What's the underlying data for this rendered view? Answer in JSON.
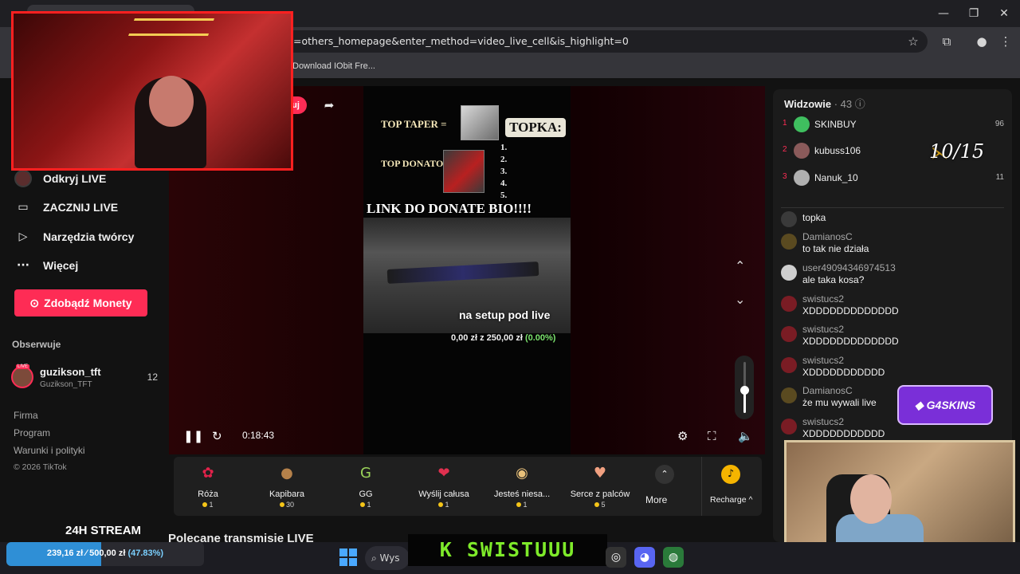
{
  "browser": {
    "url": "=others_homepage&enter_method=video_live_cell&is_highlight=0",
    "bookmark": "Download IObit Fre...",
    "window_controls": [
      "minimize-icon",
      "restore-icon",
      "close-icon"
    ]
  },
  "sidebar": {
    "nav": [
      {
        "label": "Odkryj LIVE",
        "icon": "avatar-icon"
      },
      {
        "label": "ZACZNIJ LIVE",
        "icon": "camera-icon"
      },
      {
        "label": "Narzędzia twórcy",
        "icon": "play-icon"
      },
      {
        "label": "Więcej",
        "icon": "more-dots-icon"
      }
    ],
    "coins_button": "Zdobądź Monety",
    "following_title": "Obserwuje",
    "following": {
      "name": "guzikson_tft",
      "handle": "Guzikson_TFT",
      "count": "12",
      "badge": "LIVE"
    },
    "footer": [
      "Firma",
      "Program",
      "Warunki i polityki"
    ],
    "copyright": "© 2026 TikTok",
    "stream_label": "24H STREAM"
  },
  "player": {
    "follow_short": "uj",
    "overlay": {
      "top_taper": "TOP TAPER =",
      "topka": "TOPKA:",
      "top_donator": "TOP DONATOR:",
      "numbers": [
        "1.",
        "2.",
        "3.",
        "4.",
        "5."
      ],
      "link": "LINK DO DONATE BIO!!!!",
      "caption": "na setup pod live",
      "goal_amount": "0,00 zł z 250,00 zł",
      "goal_percent": "(0.00%)"
    },
    "time": "0:18:43",
    "volume_level": 0.45
  },
  "gifts": {
    "items": [
      {
        "name": "Róża",
        "price": "1",
        "icon": "rose-icon",
        "color": "#e0224a"
      },
      {
        "name": "Kapibara",
        "price": "30",
        "icon": "capybara-icon",
        "color": "#b5814a"
      },
      {
        "name": "GG",
        "price": "1",
        "icon": "gg-icon",
        "color": "#9bd45a"
      },
      {
        "name": "Wyślij całusa",
        "price": "1",
        "icon": "lips-icon",
        "color": "#e0304f"
      },
      {
        "name": "Jesteś niesa...",
        "price": "1",
        "icon": "cat-icon",
        "color": "#e8c07a"
      },
      {
        "name": "Serce z palców",
        "price": "5",
        "icon": "finger-heart-icon",
        "color": "#f0a080"
      }
    ],
    "more": "More",
    "recharge": "Recharge ^"
  },
  "recommended_title": "Polecane transmisje LIVE",
  "chat": {
    "header": "Widzowie",
    "viewer_count": "· 43",
    "ranking": [
      {
        "rank": "1",
        "name": "SKINBUY",
        "score": "96",
        "color": "#3fbf5f"
      },
      {
        "rank": "2",
        "name": "kubuss106",
        "score": "",
        "color": "#8a5a5a"
      },
      {
        "rank": "3",
        "name": "Nanuk_10",
        "score": "11",
        "color": "#b0b0b0"
      }
    ],
    "messages": [
      {
        "user": "",
        "text": "topka"
      },
      {
        "user": "DamianosC",
        "text": "to tak nie działa"
      },
      {
        "user": "user49094346974513",
        "text": "ale taka kosa?"
      },
      {
        "user": "swistucs2",
        "text": "XDDDDDDDDDDDDD"
      },
      {
        "user": "swistucs2",
        "text": "XDDDDDDDDDDDDD"
      },
      {
        "user": "swistucs2",
        "text": "XDDDDDDDDDDD"
      },
      {
        "user": "DamianosC",
        "text": "że mu wywali live"
      },
      {
        "user": "swistucs2",
        "text": "XDDDDDDDDDDD"
      }
    ]
  },
  "overlays": {
    "score": "10/15",
    "g4skins": "G4SKINS",
    "marquee": "K SWISTUUU"
  },
  "donate_bar": {
    "text": "239,16 zł ⁄ 500,00 zł",
    "percent_label": "(47.83%)",
    "fraction": 0.4783
  },
  "taskbar": {
    "search_placeholder": "Wys"
  }
}
